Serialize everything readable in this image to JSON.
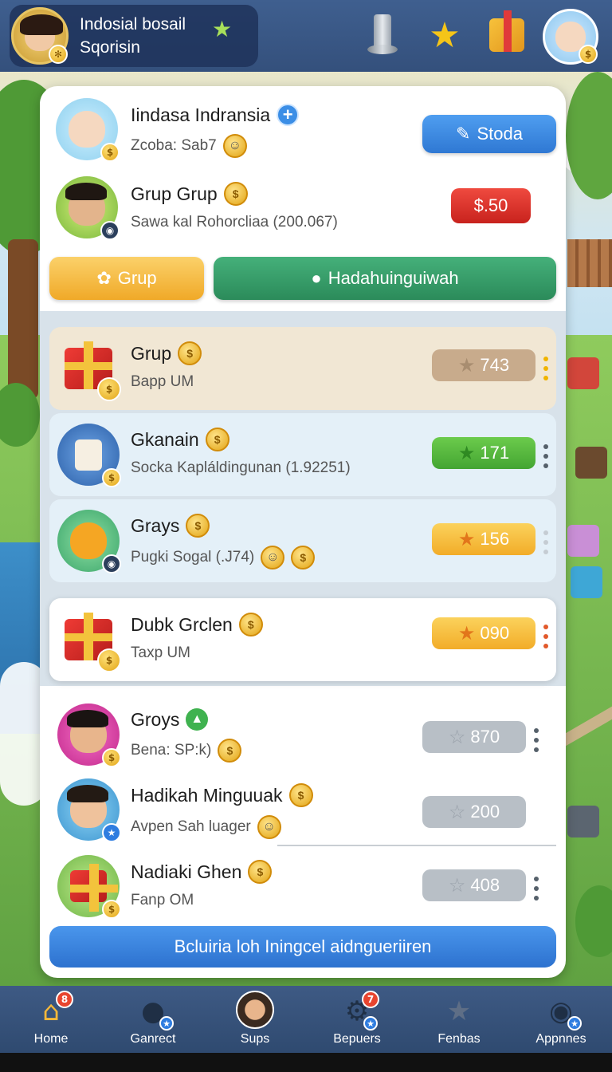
{
  "header": {
    "profile_line1": "Indosial bosail",
    "profile_line2": "Sqorisin"
  },
  "top_card": {
    "user": {
      "name": "Iindasa Indransia",
      "sub": "Zcoba: Sab7",
      "button": "Stoda"
    },
    "group": {
      "name": "Grup Grup",
      "sub": "Sawa kal Rohorcliaa (200.067)",
      "price": "$.50"
    }
  },
  "tabs": [
    {
      "label": "Grup"
    },
    {
      "label": "Hadahuinguiwah"
    }
  ],
  "list": [
    {
      "name": "Grup",
      "sub": "Bapp UM",
      "score": "743"
    },
    {
      "name": "Gkanain",
      "sub": "Socka Kapláldingunan (1.92251)",
      "score": "171"
    },
    {
      "name": "Grays",
      "sub": "Pugki Sogal (.J74)",
      "score": "156"
    },
    {
      "name": "Dubk Grclen",
      "sub": "Taxp UM",
      "score": "090"
    },
    {
      "name": "Groys",
      "sub": "Bena: SP:k)",
      "score": "870"
    },
    {
      "name": "Hadikah Minguuak",
      "sub": "Avpen Sah luager",
      "score": "200"
    },
    {
      "name": "Nadiaki Ghen",
      "sub": "Fanp OM",
      "score": "408"
    }
  ],
  "cta": {
    "label": "Bcluiria loh Iningcel aidngueriiren"
  },
  "nav": [
    {
      "label": "Home",
      "badge": "8"
    },
    {
      "label": "Ganrect"
    },
    {
      "label": "Sups"
    },
    {
      "label": "Bepuers",
      "badge": "7"
    },
    {
      "label": "Fenbas"
    },
    {
      "label": "Appnnes"
    }
  ],
  "colors": {
    "accent_blue": "#2f78d3",
    "accent_green": "#2b8b5a",
    "accent_yellow": "#f0a928",
    "price_red": "#c8221d"
  }
}
